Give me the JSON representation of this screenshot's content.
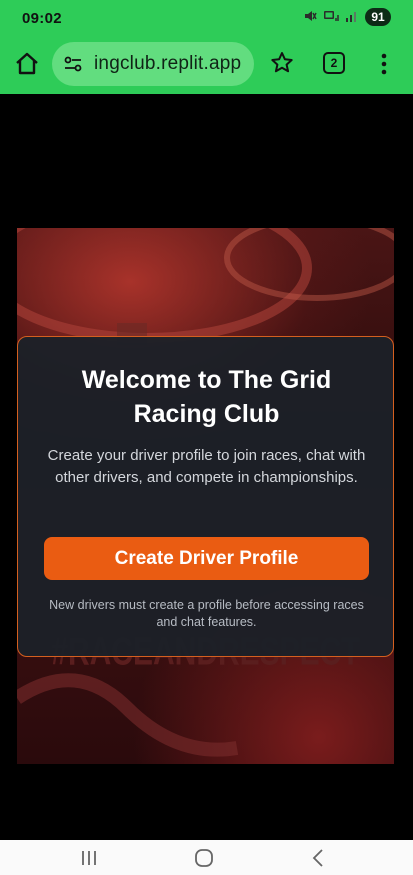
{
  "status_bar": {
    "time": "09:02",
    "battery": "91"
  },
  "browser": {
    "url": "ingclub.replit.app",
    "tab_count": "2"
  },
  "hero": {
    "slogan": "#RACEANDRESPECT"
  },
  "modal": {
    "title": "Welcome to The Grid Racing Club",
    "body": "Create your driver profile to join races, chat with other drivers, and compete in championships.",
    "cta_label": "Create Driver Profile",
    "note": "New drivers must create a profile before accessing races and chat features."
  },
  "colors": {
    "browser_green": "#2ecc58",
    "accent_orange": "#ea5c12"
  },
  "icons": {
    "home": "home-icon",
    "site_settings": "tune-icon",
    "bookmark": "star-icon",
    "tabs": "tabs-icon",
    "menu": "more-vert-icon",
    "nav_recents": "recents-icon",
    "nav_home": "nav-home-icon",
    "nav_back": "back-icon"
  }
}
